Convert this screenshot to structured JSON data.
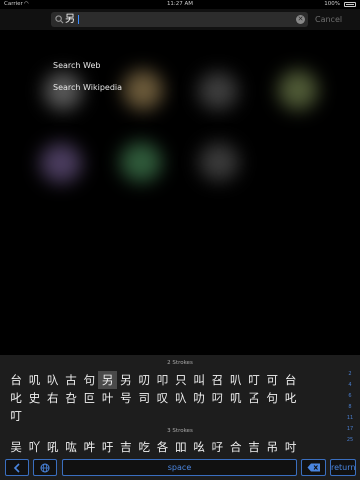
{
  "status_bar": {
    "carrier": "Carrier",
    "time": "11:27 AM",
    "battery": "100%"
  },
  "search": {
    "query": "另",
    "cancel_label": "Cancel"
  },
  "suggestions": [
    "Search Web",
    "Search Wikipedia"
  ],
  "keyboard": {
    "group1_header": "2 Strokes",
    "row1": [
      "台",
      "叽",
      "叺",
      "古",
      "句",
      "另",
      "另",
      "叨",
      "叩",
      "只",
      "叫",
      "召",
      "叭",
      "叮",
      "可",
      "台"
    ],
    "row2": [
      "叱",
      "史",
      "右",
      "叴",
      "叵",
      "叶",
      "号",
      "司",
      "叹",
      "叺",
      "叻",
      "叼",
      "叽",
      "叾",
      "句",
      "叱"
    ],
    "row3": [
      "叮"
    ],
    "group2_header": "3 Strokes",
    "row4": [
      "吴",
      "吖",
      "吼",
      "吰",
      "吽",
      "吁",
      "吉",
      "吃",
      "各",
      "吅",
      "吆",
      "吇",
      "合",
      "吉",
      "吊",
      "吋"
    ],
    "index": [
      "2",
      "4",
      "6",
      "8",
      "11",
      "17",
      "25"
    ],
    "space_label": "space",
    "return_label": "return"
  },
  "colors": {
    "accent": "#3b8cff",
    "key_border": "#3a6fc0"
  }
}
